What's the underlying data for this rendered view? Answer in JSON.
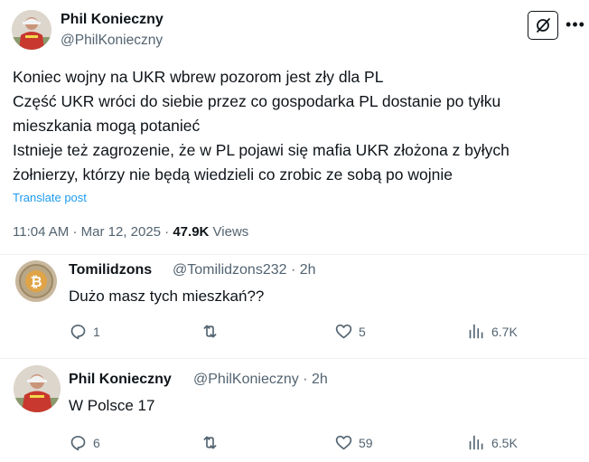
{
  "post": {
    "author_name": "Phil Konieczny",
    "author_handle": "@PhilKonieczny",
    "lines": [
      "Koniec wojny na UKR wbrew pozorom jest zły dla PL",
      "Część UKR wróci do siebie przez co gospodarka PL dostanie po tyłku",
      "mieszkania mogą potanieć",
      "Istnieje też zagrozenie, że w PL pojawi się mafia UKR złożona z byłych",
      "żołnierzy, którzy nie będą wiedzieli co zrobic ze sobą po wojnie"
    ],
    "translate_label": "Translate post",
    "time": "11:04 AM",
    "date": "Mar 12, 2025",
    "views_count": "47.9K",
    "views_label": "Views"
  },
  "replies": [
    {
      "name": "Tomilidzons",
      "handle": "@Tomilidzons232",
      "age": "2h",
      "text": "Dużo masz tych mieszkań??",
      "replies": "1",
      "reposts": "",
      "likes": "5",
      "views": "6.7K"
    },
    {
      "name": "Phil Konieczny",
      "handle": "@PhilKonieczny",
      "age": "2h",
      "text": "W Polsce 17",
      "replies": "6",
      "reposts": "",
      "likes": "59",
      "views": "6.5K"
    }
  ],
  "colors": {
    "text": "#0f1419",
    "secondary": "#536471",
    "link": "#1d9bf0",
    "divider": "#eff3f4"
  },
  "icons": {
    "grok": "grok-icon",
    "more": "more-icon",
    "reply": "reply-icon",
    "repost": "repost-icon",
    "like": "like-icon",
    "views": "views-icon"
  }
}
